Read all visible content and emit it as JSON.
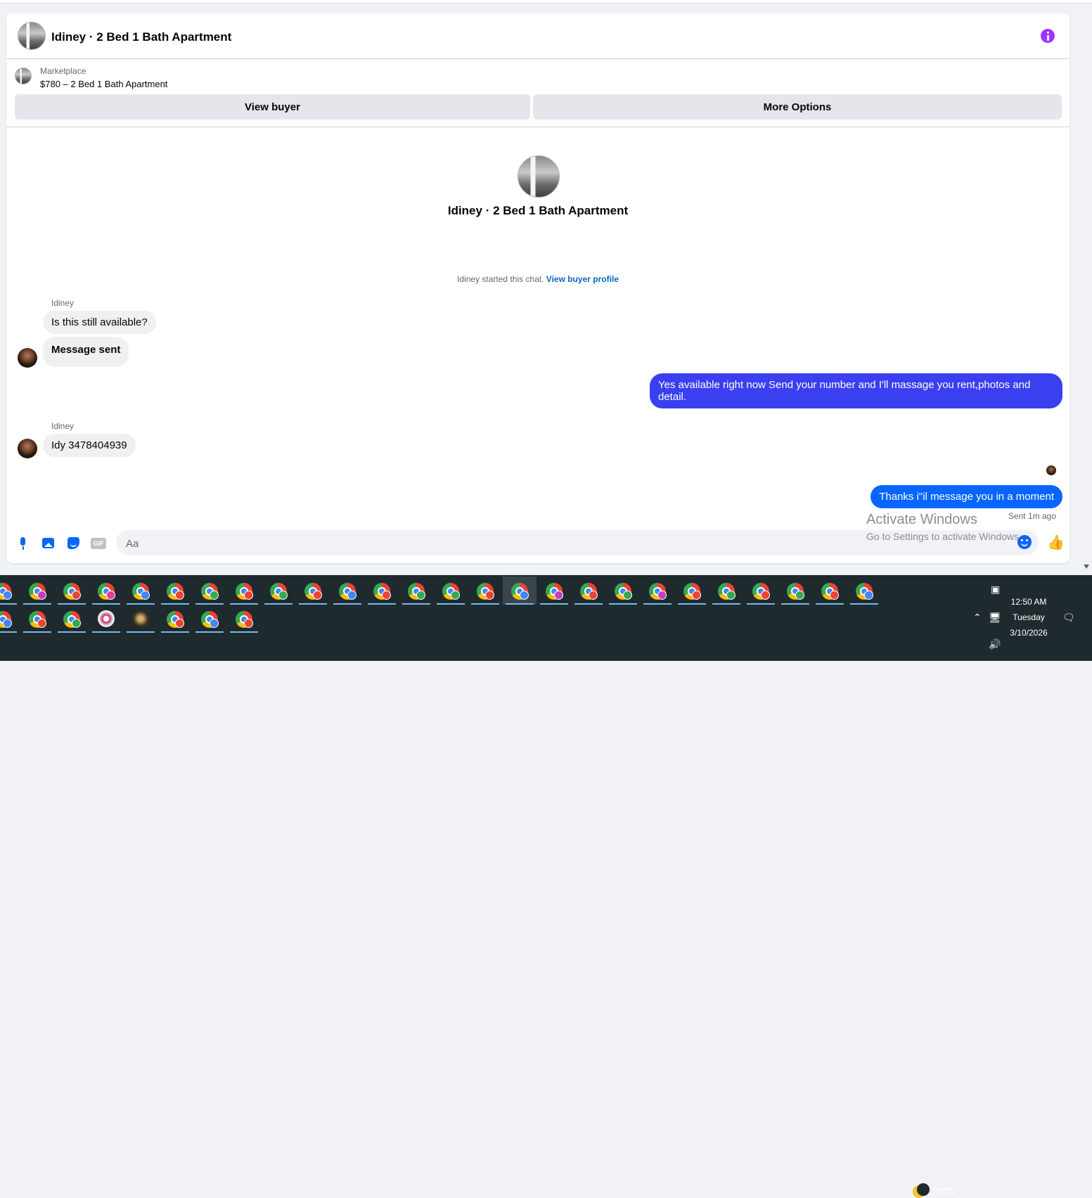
{
  "conversation": {
    "title": "Idiney · 2 Bed 1 Bath Apartment",
    "marketplace_label": "Marketplace",
    "listing": "$780 – 2 Bed 1 Bath Apartment",
    "view_buyer_button": "View buyer",
    "more_options_button": "More Options",
    "center_name": "Idiney · 2 Bed 1 Bath Apartment",
    "started_text": "Idiney started this chat.",
    "view_buyer_profile_link": "View buyer profile"
  },
  "messages": {
    "sender_name_1": "Idiney",
    "msg_1": "Is this still available?",
    "msg_2": "Message sent",
    "out_1": "Yes available right now Send your number and I'll massage you rent,photos and detail.",
    "sender_name_2": "Idiney",
    "msg_3": "Idy 3478404939",
    "out_2": "Thanks i\"il message you in a moment",
    "sent_status": "Sent 1m ago"
  },
  "composer": {
    "placeholder": "Aa",
    "gif_label": "GIF"
  },
  "watermark": {
    "line1": "Activate Windows",
    "line2": "Go to Settings to activate Windows."
  },
  "taskbar": {
    "weather": "22°C",
    "time": "12:50 AM",
    "day": "Tuesday",
    "date": "3/10/2026"
  },
  "colors": {
    "accent_blue": "#0866ff",
    "outgoing_bubble_1": "#3a3ff0",
    "info_purple": "#a033ff",
    "taskbar_bg": "#1f2a2e"
  }
}
